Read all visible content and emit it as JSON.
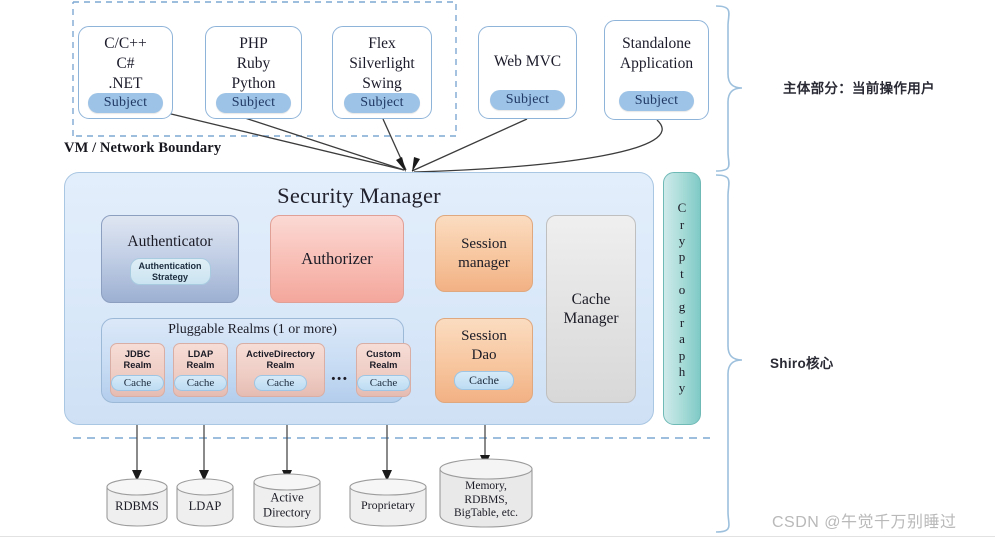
{
  "clients": [
    {
      "name": "client-c-cpp",
      "lines": "C/C++\nC#\n.NET",
      "subject": "Subject"
    },
    {
      "name": "client-php",
      "lines": "PHP\nRuby\nPython",
      "subject": "Subject"
    },
    {
      "name": "client-flex",
      "lines": "Flex\nSilverlight\nSwing",
      "subject": "Subject"
    },
    {
      "name": "client-webmvc",
      "lines": "Web MVC",
      "subject": "Subject"
    },
    {
      "name": "client-standalone",
      "lines": "Standalone\nApplication",
      "subject": "Subject"
    }
  ],
  "boundary_label": "VM / Network Boundary",
  "security_manager": {
    "title": "Security Manager",
    "authenticator": {
      "label": "Authenticator",
      "strategy": "Authentication\nStrategy"
    },
    "authorizer": {
      "label": "Authorizer"
    },
    "session_manager": {
      "label": "Session\nmanager"
    },
    "session_dao": {
      "label": "Session\nDao",
      "cache": "Cache"
    },
    "cache_manager": {
      "label": "Cache\nManager"
    },
    "realms": {
      "title": "Pluggable Realms (1 or more)",
      "ellipsis": "...",
      "items": [
        {
          "label": "JDBC\nRealm",
          "cache": "Cache"
        },
        {
          "label": "LDAP\nRealm",
          "cache": "Cache"
        },
        {
          "label": "ActiveDirectory\nRealm",
          "cache": "Cache"
        },
        {
          "label": "Custom\nRealm",
          "cache": "Cache"
        }
      ]
    }
  },
  "cryptography": {
    "label": "Cryptography"
  },
  "datastores": [
    {
      "name": "datastore-rdbms",
      "label": "RDBMS"
    },
    {
      "name": "datastore-ldap",
      "label": "LDAP"
    },
    {
      "name": "datastore-active-dir",
      "label": "Active\nDirectory"
    },
    {
      "name": "datastore-proprietary",
      "label": "Proprietary"
    },
    {
      "name": "datastore-memory",
      "label": "Memory,\nRDBMS,\nBigTable, etc."
    }
  ],
  "annotations": {
    "subject_part": "主体部分：当前操作用户",
    "shiro_core": "Shiro核心"
  },
  "watermark": "CSDN @午觉千万别睡过",
  "colors": {
    "subject_pill": "#9dc3e6",
    "authenticator": "#9db0d2",
    "authorizer": "#f4a79c",
    "session": "#f2b184",
    "cache_manager": "#d8d8d8",
    "cryptography": "#7fc9c6",
    "boundary_dash": "#7fa8d4",
    "secmgr_bg": "#d9e8f9"
  }
}
